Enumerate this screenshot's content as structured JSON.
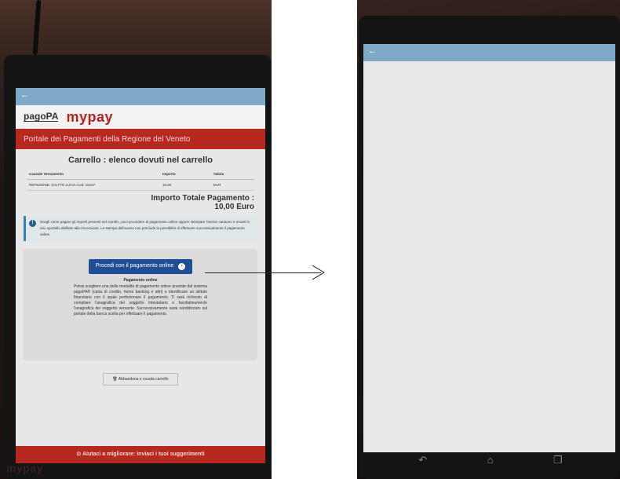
{
  "left_tablet": {
    "back_icon": "back-arrow-icon",
    "logo_pagopa": "pagoPA",
    "logo_mypay": "mypay",
    "header_title": "Portale dei Pagamenti della Regione del Veneto",
    "cart_title": "Carrello : elenco dovuti nel carrello",
    "table": {
      "headers": [
        "Causale Versamento",
        "Importo",
        "Valuta"
      ],
      "rows": [
        [
          "REFEZIONE: SALTTO LUCIA Cod: 15107",
          "10,00",
          "EUR"
        ]
      ]
    },
    "total_label": "Importo Totale Pagamento :",
    "total_value": "10,00 Euro",
    "info_text": "Scegli come pagare gli importi presenti nel carrello, puoi procedere al pagamento online oppure stampare l'avviso cartaceo e recarti in uno sportello abilitato alla riscossione. La stampa dell'avviso non preclude la possibilità di effettuare successivamente il pagamento online.",
    "pay_button_label": "Procedi con il pagamento online",
    "pay_section_title": "Pagamento online",
    "pay_section_text": "Potrai scegliere una delle modalità di pagamento online previste dal sistema pagoPA® (carta di credito, home banking e altri) e identificare un istituto finanziario con il quale perfezionare il pagamento. Ti sarà richiesto di compilare l'anagrafica del soggetto intestatario e facoltativamente l'anagrafica del soggetto versante. Successivamente sarai reindirizzato sul portale della banca scelta per effettuare il pagamento.",
    "abandon_button_label": "Abbandona e svuota carrello",
    "feedback_bar": "Aiutaci a migliorare: inviaci i tuoi suggerimenti"
  },
  "photo_logo": {
    "prefix": "my",
    "suffix": "pay"
  },
  "right_tablet": {
    "back_icon": "back-arrow-icon",
    "nav_icons": [
      "back-nav-icon",
      "home-nav-icon",
      "recent-apps-icon"
    ]
  },
  "colors": {
    "app_topbar": "#7fa9c6",
    "brand_red": "#b7281e",
    "button_blue": "#1f4e96"
  }
}
